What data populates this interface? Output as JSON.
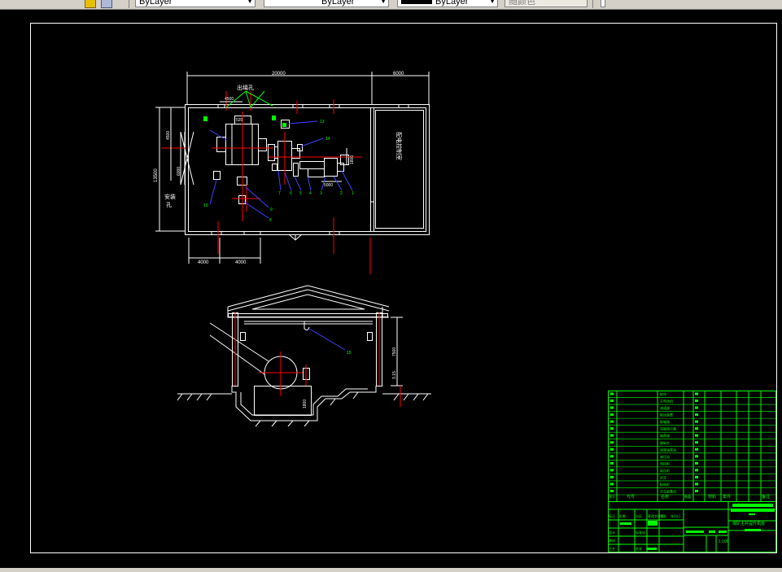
{
  "toolbar": {
    "layer_field": "ByLayer",
    "linetype_field": "ByLayer",
    "lineweight_field": "ByLayer",
    "plotstyle_field": "随颜色"
  },
  "plan": {
    "dim_total": "20000",
    "dim_side": "6000",
    "dim_small": "4500",
    "dim_small2": "520",
    "dim_left_h": "13500",
    "dim_left_top": "4500",
    "dim_left_mid": "6000",
    "dim_right_mid": "1800",
    "dim_inner": "5000",
    "dim_bottom_left": "4000",
    "dim_bottom_mid": "4000",
    "label_rope": "出绳孔",
    "label_install": "安装",
    "label_install2": "孔",
    "label_room": "配电控制室",
    "callouts": [
      "13",
      "14",
      "10",
      "9",
      "8",
      "7",
      "6",
      "5",
      "4",
      "3",
      "2",
      "1",
      "11",
      "12"
    ]
  },
  "section": {
    "dim_height": "7500",
    "dim_small": "3.15",
    "dim_pit": "1800",
    "callout": "15"
  },
  "title_block": {
    "project": "煤矿主井提升机房",
    "scale": "1:100",
    "rows": [
      "绞车",
      "主电动机",
      "减速器",
      "制动装置",
      "联轴器",
      "深度指示器",
      "轴承座",
      "操纵台",
      "润滑油泵站",
      "液压站",
      "电控柜",
      "高压柜",
      "吊车",
      "配电柜",
      "天车起重机"
    ],
    "headers": [
      "序号",
      "代号",
      "名称",
      "数量",
      "材料",
      "单件",
      "总计",
      "备注"
    ],
    "sign_labels": [
      "标记",
      "处数",
      "分区",
      "更改文件号",
      "签名",
      "年月日"
    ],
    "sign_labels2": [
      "设计",
      "标准化",
      "审核",
      "工艺",
      "批准"
    ]
  },
  "colors": {
    "line": "#ffffff",
    "green": "#00ff00",
    "red": "#ff0000",
    "blue": "#4040ff",
    "yellow": "#ffff00"
  }
}
